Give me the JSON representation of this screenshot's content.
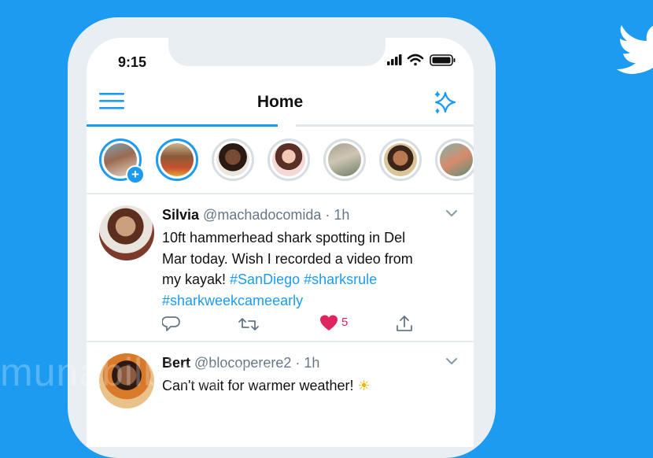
{
  "brand": {
    "logo_icon": "twitter-bird-icon",
    "accent": "#1d9bf0",
    "background": "#1d9bf0"
  },
  "status_bar": {
    "time": "9:15",
    "icons": [
      "signal-icon",
      "wifi-icon",
      "battery-icon"
    ]
  },
  "header": {
    "title": "Home",
    "left_icon": "menu-icon",
    "right_icon": "sparkle-icon"
  },
  "fleets": [
    {
      "name": "your-fleet",
      "active": true,
      "add": "+"
    },
    {
      "name": "fleet-2",
      "active": true
    },
    {
      "name": "fleet-3",
      "active": false
    },
    {
      "name": "fleet-4",
      "active": false
    },
    {
      "name": "fleet-5",
      "active": false
    },
    {
      "name": "fleet-6",
      "active": false
    },
    {
      "name": "fleet-7",
      "active": false
    }
  ],
  "tweets": [
    {
      "name": "Silvia",
      "handle": "@machadocomida",
      "time": "· 1h",
      "text_lines": [
        "10ft hammerhead shark spotting in Del",
        "Mar today. Wish I recorded a video from",
        "my kayak! "
      ],
      "hashtags": [
        "#SanDiego",
        "#sharksrule",
        "#sharkweekcameearly"
      ],
      "likes": "5"
    },
    {
      "name": "Bert",
      "handle": "@blocoperere2",
      "time": "· 1h",
      "text": "Can't wait for warmer weather!",
      "emoji": "☀"
    }
  ],
  "watermark": "munabilbloging"
}
